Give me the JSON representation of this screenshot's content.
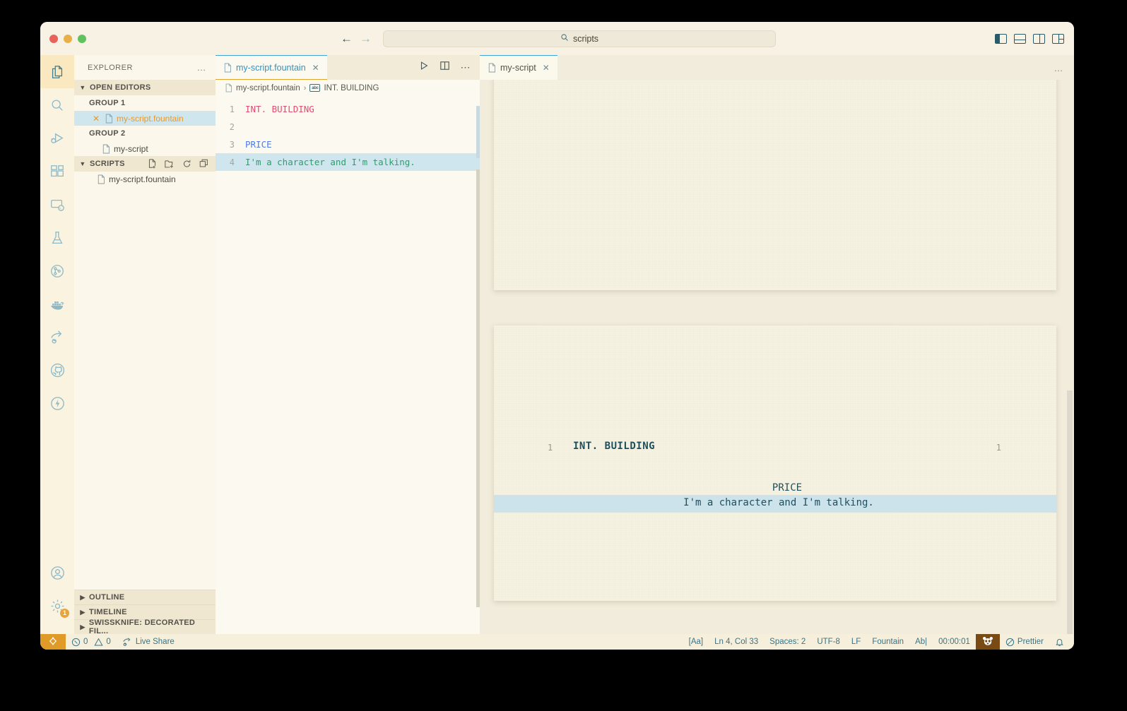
{
  "window": {
    "traffic_lights": [
      "close",
      "minimize",
      "maximize"
    ]
  },
  "titlebar": {
    "back_label": "←",
    "forward_label": "→",
    "search_value": "scripts",
    "search_icon": "search-icon",
    "layout_icons": [
      "toggle-primary-sidebar",
      "toggle-panel",
      "toggle-secondary-sidebar",
      "customize-layout"
    ]
  },
  "activitybar": {
    "items": [
      {
        "name": "explorer",
        "icon": "files-icon",
        "active": true
      },
      {
        "name": "search",
        "icon": "search-icon",
        "active": false
      },
      {
        "name": "run-and-debug",
        "icon": "debug-icon",
        "active": false
      },
      {
        "name": "extensions",
        "icon": "extensions-icon",
        "active": false
      },
      {
        "name": "remote-explorer",
        "icon": "remote-icon",
        "active": false
      },
      {
        "name": "testing",
        "icon": "beaker-icon",
        "active": false
      },
      {
        "name": "source-control-graph",
        "icon": "git-graph-icon",
        "active": false
      },
      {
        "name": "docker",
        "icon": "docker-icon",
        "active": false
      },
      {
        "name": "live-share",
        "icon": "live-share-icon",
        "active": false
      },
      {
        "name": "github",
        "icon": "github-icon",
        "active": false
      },
      {
        "name": "thunder-client",
        "icon": "lightning-icon",
        "active": false
      }
    ],
    "accounts": {
      "icon": "account-icon"
    },
    "settings": {
      "icon": "gear-icon",
      "badge": "1"
    }
  },
  "sidebar": {
    "title": "EXPLORER",
    "more_actions": "…",
    "sections": [
      {
        "label": "OPEN EDITORS",
        "expanded": true,
        "groups": [
          {
            "label": "GROUP 1",
            "items": [
              {
                "label": "my-script.fountain",
                "selected": true,
                "close": "✕",
                "icon": "file-icon"
              }
            ]
          },
          {
            "label": "GROUP 2",
            "items": [
              {
                "label": "my-script",
                "selected": false,
                "icon": "file-icon"
              }
            ]
          }
        ]
      },
      {
        "label": "SCRIPTS",
        "expanded": true,
        "actions": [
          "new-file-icon",
          "new-folder-icon",
          "refresh-icon",
          "collapse-all-icon"
        ],
        "files": [
          {
            "label": "my-script.fountain",
            "icon": "file-icon"
          }
        ]
      }
    ],
    "bottom_sections": [
      {
        "label": "OUTLINE",
        "expanded": false
      },
      {
        "label": "TIMELINE",
        "expanded": false
      },
      {
        "label": "SWISSKNIFE: DECORATED FIL...",
        "expanded": false
      }
    ]
  },
  "editor_group_1": {
    "tabs": [
      {
        "label": "my-script.fountain",
        "active": true,
        "close": "✕",
        "icon": "file-icon"
      }
    ],
    "actions": [
      "run-icon",
      "split-editor-icon",
      "more-actions-icon"
    ],
    "breadcrumb": {
      "file": "my-script.fountain",
      "separator": "›",
      "symbol": "INT. BUILDING",
      "symbol_icon": "abc-icon"
    },
    "code_lines": [
      {
        "num": "1",
        "text": "INT. BUILDING",
        "kind": "scene",
        "highlighted": false
      },
      {
        "num": "2",
        "text": "",
        "kind": "plain",
        "highlighted": false
      },
      {
        "num": "3",
        "text": "PRICE",
        "kind": "character",
        "highlighted": false
      },
      {
        "num": "4",
        "text": "I'm a character and I'm talking.",
        "kind": "dialogue",
        "highlighted": true
      }
    ]
  },
  "preview": {
    "tabs": [
      {
        "label": "my-script",
        "active": true,
        "close": "✕",
        "icon": "file-icon"
      }
    ],
    "more_actions": "…",
    "script": {
      "scene_heading": "INT. BUILDING",
      "scene_number_left": "1",
      "scene_number_right": "1",
      "character": "PRICE",
      "dialogue": "I'm a character and I'm talking."
    }
  },
  "statusbar": {
    "remote_icon": "remote-window-icon",
    "left": [
      {
        "name": "problems",
        "icon": "error-icon",
        "errors": "0",
        "warn_icon": "warning-icon",
        "warnings": "0"
      },
      {
        "name": "live-share",
        "icon": "live-share-icon",
        "label": "Live Share"
      }
    ],
    "right": [
      {
        "name": "screencast",
        "label": "[Aa]"
      },
      {
        "name": "cursor-position",
        "label": "Ln 4, Col 33"
      },
      {
        "name": "indentation",
        "label": "Spaces: 2"
      },
      {
        "name": "encoding",
        "label": "UTF-8"
      },
      {
        "name": "eol",
        "label": "LF"
      },
      {
        "name": "language-mode",
        "label": "Fountain"
      },
      {
        "name": "word-wrap",
        "label": "Ab|"
      },
      {
        "name": "timer",
        "label": "00:00:01"
      },
      {
        "name": "panda-badge",
        "icon": "panda-icon"
      },
      {
        "name": "prettier",
        "icon": "circle-slash-icon",
        "label": "Prettier"
      },
      {
        "name": "notifications",
        "icon": "bell-icon"
      }
    ]
  },
  "colors": {
    "accent_blue": "#3FA4D4",
    "accent_orange": "#E3A52B",
    "selection": "#CFE6EF",
    "scene_pink": "#E34B70",
    "character_blue": "#4B7BE8",
    "dialogue_green": "#2E9E6B",
    "remote_orange": "#E09A28",
    "badge_brown": "#7A4A15"
  }
}
